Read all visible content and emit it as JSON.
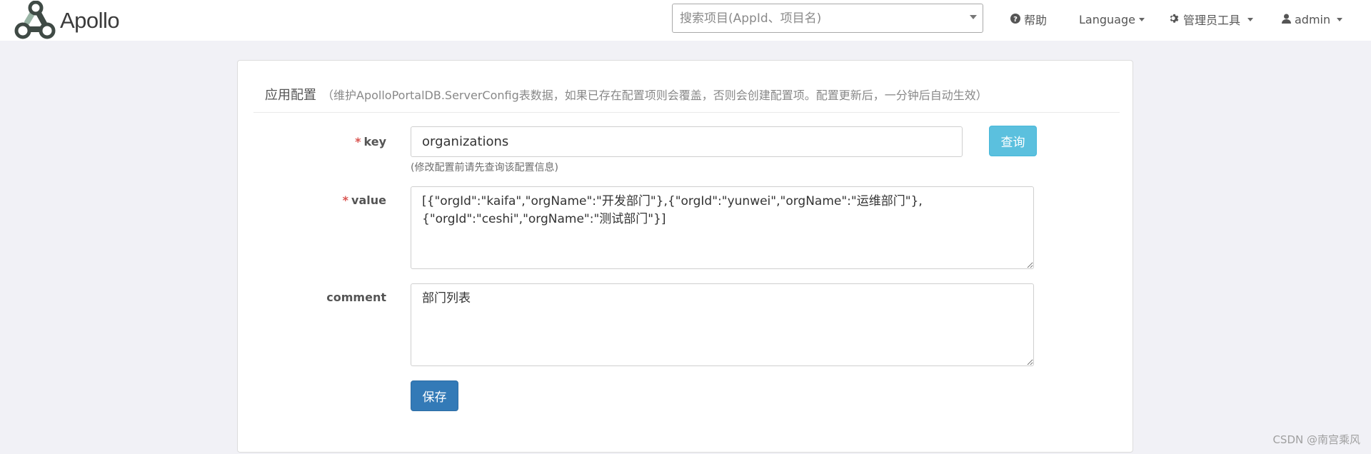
{
  "navbar": {
    "brand": "Apollo",
    "search_placeholder": "搜索项目(AppId、项目名)",
    "help_label": "帮助",
    "language_label": "Language",
    "admin_tools_label": "管理员工具",
    "user_label": "admin"
  },
  "panel": {
    "title": "应用配置",
    "description": "（维护ApolloPortalDB.ServerConfig表数据，如果已存在配置项则会覆盖，否则会创建配置项。配置更新后，一分钟后自动生效）",
    "key_label": "key",
    "key_value": "organizations",
    "key_help": "(修改配置前请先查询该配置信息)",
    "query_button": "查询",
    "value_label": "value",
    "value_text": "[{\"orgId\":\"kaifa\",\"orgName\":\"开发部门\"},{\"orgId\":\"yunwei\",\"orgName\":\"运维部门\"},{\"orgId\":\"ceshi\",\"orgName\":\"测试部门\"}]",
    "comment_label": "comment",
    "comment_text": "部门列表",
    "save_button": "保存",
    "required_marker": "*"
  },
  "watermark": "CSDN @南宫乘风"
}
